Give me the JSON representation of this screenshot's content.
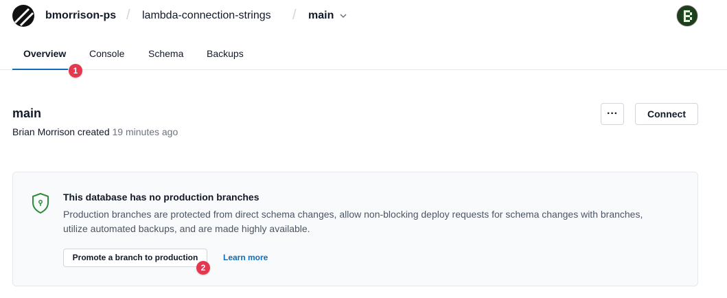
{
  "header": {
    "org": "bmorrison-ps",
    "separator": "/",
    "database": "lambda-connection-strings",
    "branch": "main"
  },
  "tabs": [
    {
      "label": "Overview",
      "active": true
    },
    {
      "label": "Console",
      "active": false
    },
    {
      "label": "Schema",
      "active": false
    },
    {
      "label": "Backups",
      "active": false
    }
  ],
  "annotations": {
    "badge1": "1",
    "badge2": "2"
  },
  "branch_info": {
    "name": "main",
    "author": "Brian Morrison",
    "action": "created",
    "time": "19 minutes ago"
  },
  "actions": {
    "more_label": "···",
    "connect_label": "Connect"
  },
  "notice": {
    "title": "This database has no production branches",
    "description": "Production branches are protected from direct schema changes, allow non-blocking deploy requests for schema changes with branches, utilize automated backups, and are made highly available.",
    "promote_label": "Promote a branch to production",
    "learn_more_label": "Learn more"
  },
  "colors": {
    "accent": "#0f6cbd",
    "badge": "#e5384f",
    "shield": "#2e8b3a"
  },
  "icons": {
    "logo": "planetscale-logo-icon",
    "chevron": "chevron-down-icon",
    "avatar": "user-avatar",
    "notice": "shield-icon"
  }
}
